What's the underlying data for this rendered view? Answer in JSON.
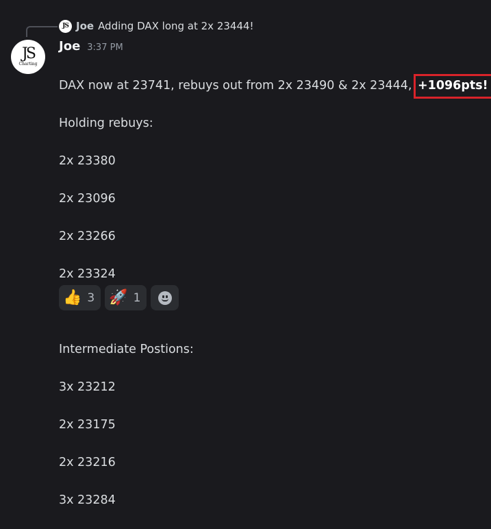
{
  "reply": {
    "author": "Joe",
    "text": "Adding DAX long at 2x 23444!"
  },
  "avatar": {
    "logo": "JS",
    "sub": "Charting"
  },
  "message": {
    "author": "Joe",
    "time": "3:37 PM",
    "first_line_text": "DAX now at 23741, rebuys out from 2x 23490 & 2x 23444, ",
    "highlight": "+1096pts!",
    "lines": [
      "Holding rebuys:",
      "2x 23380",
      "2x 23096",
      "2x 23266",
      "2x 23324",
      "",
      "Intermediate Postions:",
      "3x 23212",
      "2x 23175",
      "2x 23216",
      "3x 23284"
    ]
  },
  "reactions": [
    {
      "emoji": "👍",
      "icon": "thumbs-up-icon",
      "count": "3"
    },
    {
      "emoji": "🚀",
      "icon": "rocket-icon",
      "count": "1"
    }
  ],
  "colors": {
    "background": "#1a1a1e",
    "highlight_box": "#d9232a",
    "reaction_bg": "#2b2d31"
  }
}
